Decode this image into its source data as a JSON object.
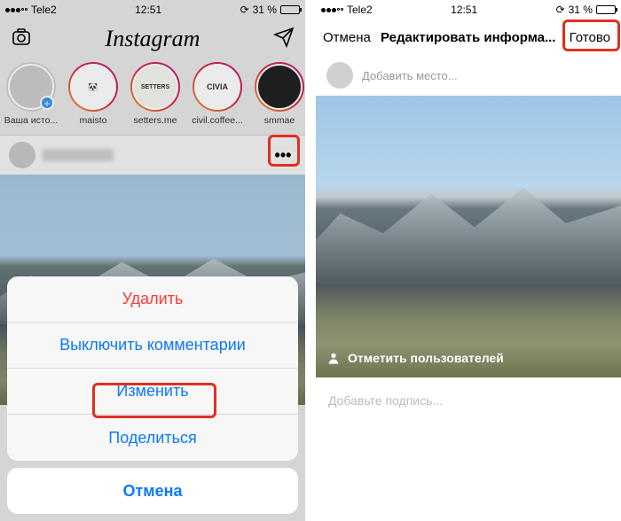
{
  "status": {
    "carrier": "Tele2",
    "time": "12:51",
    "battery_pct": "31 %",
    "lock": "⏏"
  },
  "left": {
    "logo": "Instagram",
    "stories": [
      {
        "label": "Ваша исто...",
        "avatar_text": ""
      },
      {
        "label": "maisto",
        "avatar_text": "🐼"
      },
      {
        "label": "setters.me",
        "avatar_text": "SETTERS"
      },
      {
        "label": "civil.coffee...",
        "avatar_text": "CIVIA"
      },
      {
        "label": "smmae",
        "avatar_text": ""
      }
    ],
    "sheet": {
      "delete": "Удалить",
      "mute_comments": "Выключить комментарии",
      "edit": "Изменить",
      "share": "Поделиться",
      "cancel": "Отмена"
    }
  },
  "right": {
    "nav": {
      "cancel": "Отмена",
      "title": "Редактировать информа...",
      "done": "Готово"
    },
    "add_location": "Добавить место...",
    "tag_users": "Отметить пользователей",
    "caption_placeholder": "Добавьте подпись..."
  }
}
